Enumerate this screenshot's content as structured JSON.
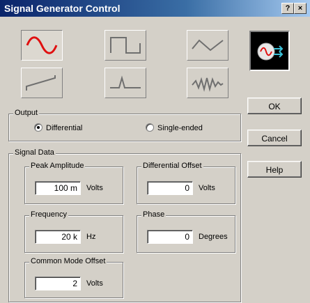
{
  "window": {
    "title": "Signal Generator Control",
    "title_help": "?",
    "close": "×"
  },
  "waveforms": [
    {
      "name": "sine",
      "selected": true
    },
    {
      "name": "square",
      "selected": false
    },
    {
      "name": "triangle",
      "selected": false
    },
    {
      "name": "sawtooth",
      "selected": false
    },
    {
      "name": "pulse",
      "selected": false
    },
    {
      "name": "noise",
      "selected": false
    }
  ],
  "buttons": {
    "ok": "OK",
    "cancel": "Cancel",
    "help": "Help"
  },
  "output": {
    "label": "Output",
    "options": [
      "Differential",
      "Single-ended"
    ],
    "selected": "Differential"
  },
  "signal_data": {
    "label": "Signal Data",
    "peak_amplitude": {
      "label": "Peak Amplitude",
      "value": "100 m",
      "unit": "Volts"
    },
    "differential_offset": {
      "label": "Differential Offset",
      "value": "0",
      "unit": "Volts"
    },
    "frequency": {
      "label": "Frequency",
      "value": "20 k",
      "unit": "Hz"
    },
    "phase": {
      "label": "Phase",
      "value": "0",
      "unit": "Degrees"
    },
    "common_mode_offset": {
      "label": "Common Mode Offset",
      "value": "2",
      "unit": "Volts"
    }
  },
  "colors": {
    "selected_wave": "#e01010",
    "unselected_wave": "#6f6f6f",
    "title_bar": "#0a246a"
  }
}
